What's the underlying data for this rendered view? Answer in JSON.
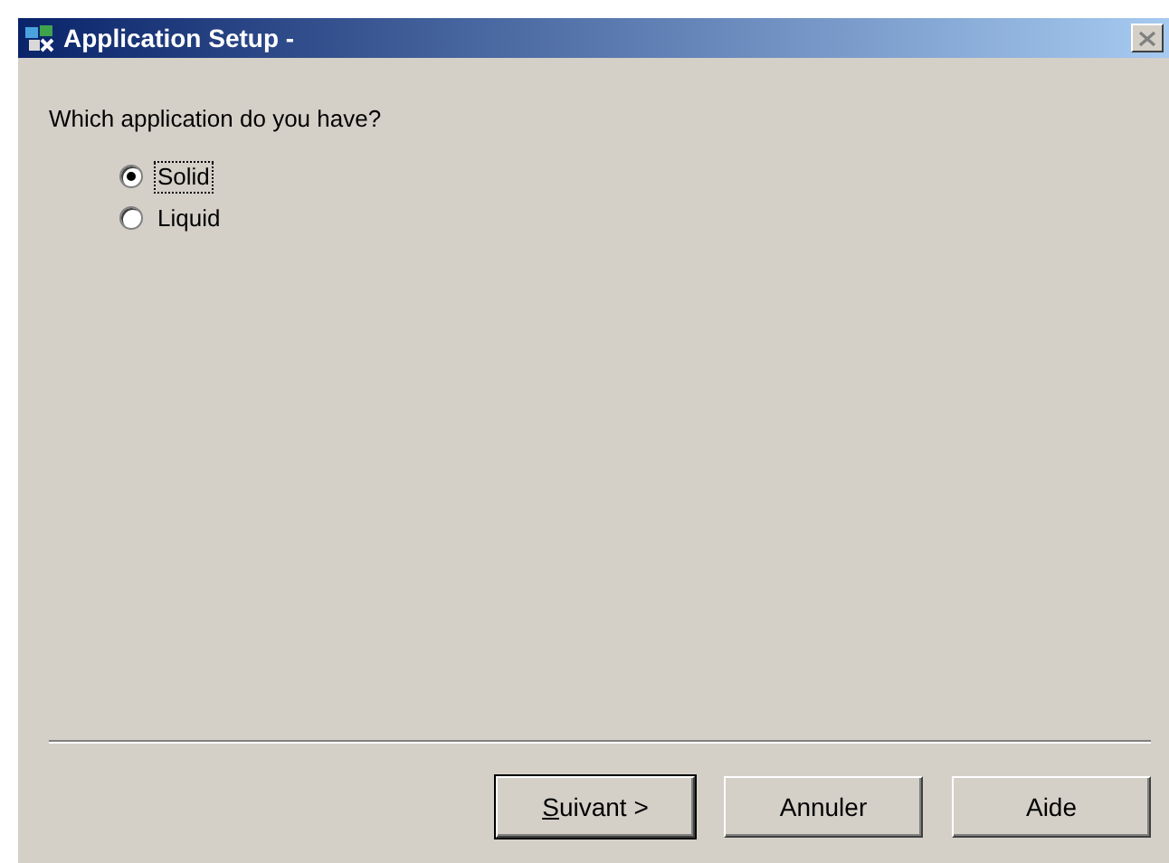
{
  "window": {
    "title": "Application Setup -"
  },
  "question": "Which application do you have?",
  "options": [
    {
      "label": "Solid",
      "selected": true,
      "focused": true
    },
    {
      "label": "Liquid",
      "selected": false,
      "focused": false
    }
  ],
  "buttons": [
    {
      "label": "Suivant >",
      "default": true,
      "mnemonic": true
    },
    {
      "label": "Annuler",
      "default": false,
      "mnemonic": false
    },
    {
      "label": "Aide",
      "default": false,
      "mnemonic": false
    }
  ]
}
